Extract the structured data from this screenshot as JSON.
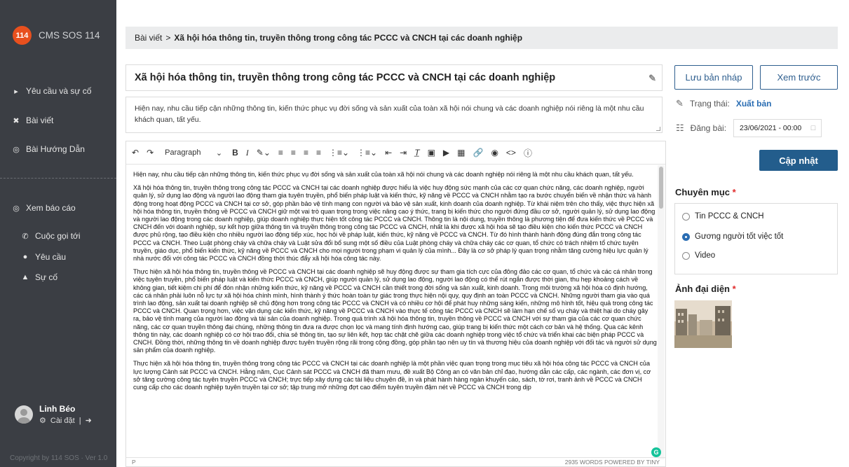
{
  "sidebar": {
    "brand_badge": "114",
    "brand_name": "CMS SOS 114",
    "items": [
      {
        "label": "Yêu cầu và sự cố",
        "icon": "megaphone-icon"
      },
      {
        "label": "Bài viết",
        "icon": "tools-icon"
      },
      {
        "label": "Bài Hướng Dẫn",
        "icon": "compass-icon"
      },
      {
        "label": "Xem báo cáo",
        "icon": "compass-icon"
      },
      {
        "label": "Cuộc gọi tới",
        "icon": "phone-icon"
      },
      {
        "label": "Yêu cầu",
        "icon": "chat-icon"
      },
      {
        "label": "Sự cố",
        "icon": "fire-icon"
      }
    ],
    "user_name": "Linh Béo",
    "settings_label": "Cài đặt",
    "divider": "|",
    "copyright": "Copyright by 114 SOS · Ver 1.0"
  },
  "breadcrumb": {
    "root": "Bài viết",
    "separator": ">",
    "current": "Xã hội hóa thông tin, truyền thông trong công tác PCCC và CNCH tại các doanh nghiệp"
  },
  "post": {
    "title": "Xã hội hóa thông tin, truyền thông  trong công tác PCCC và CNCH tại các doanh nghiệp",
    "summary": "Hiện nay, nhu cầu tiếp cận những thông tin, kiến thức phục vụ đời sống và sản xuất của toàn xã hội nói chung và các doanh nghiệp nói riêng là một nhu cầu khách quan, tất yếu."
  },
  "editor": {
    "format_select": "Paragraph",
    "paragraphs": [
      "Hiện nay, nhu cầu tiếp cận những thông tin, kiến thức phục vụ đời sống và sản xuất của toàn xã hội nói chung và các doanh nghiệp nói riêng là một nhu cầu khách quan, tất yếu.",
      "Xã hội hóa thông tin, truyền thông trong công tác PCCC và CNCH tại các doanh nghiệp được hiểu là việc huy động sức mạnh của các cơ quan chức năng, các doanh nghiệp, người quản lý, sử dụng lao động và người lao động tham gia tuyên truyền, phổ biến pháp luật và kiến thức, kỹ năng về PCCC và CNCH nhằm tạo ra bước chuyển biến về nhận thức và hành động trong hoạt động PCCC và CNCH tại cơ sở, góp phần bảo vệ tính mạng con người và bảo vệ sản xuất, kinh doanh của doanh nghiệp. Từ khái niệm trên cho thấy, việc thực hiện xã hội hóa thông tin, truyền thông về PCCC và CNCH giữ một vai trò quan trọng trong việc nâng cao ý thức, trang bị kiến thức cho người đứng đầu cơ sở, người quản lý, sử dụng lao động và người lao động trong các doanh nghiệp, giúp doanh nghiệp thực hiện tốt công tác PCCC và CNCH. Thông tin là nội dung, truyền thông là phương tiện để đưa kiến thức về PCCC và CNCH đến với doanh nghiệp, sự kết hợp giữa thông tin và truyền thông trong công tác PCCC và CNCH, nhất là khi được xã hội hóa sẽ tạo điều kiện cho kiến thức PCCC và CNCH được phủ rộng, tạo điều kiện cho nhiều người lao động tiếp xúc, học hỏi về pháp luật, kiến thức, kỹ năng về PCCC và CNCH. Từ đó hình thành hành động đúng đắn trong công tác PCCC và CNCH. Theo Luật phòng cháy và chữa cháy và Luật sửa đổi bổ sung một số điều của Luật phòng cháy và chữa cháy các cơ quan, tổ chức có trách nhiệm tổ chức tuyên truyền, giáo dục, phổ biến kiến thức, kỹ năng về PCCC và CNCH cho mọi người trong phạm vi quản lý của mình... Đây là cơ sở pháp lý quan trọng nhằm tăng cường hiệu lực quản lý nhà nước đối với công tác PCCC và CNCH đồng thời thúc đẩy xã hội hóa công tác này.",
      "Thực hiện xã hội hóa thông tin, truyền thông về PCCC và CNCH tại các doanh nghiệp sẽ huy động được sự tham gia tích cực của đông đảo các cơ quan, tổ chức và các cá nhân trong việc tuyên truyền, phổ biến pháp luật và kiến thức PCCC và CNCH, giúp người quản lý, sử dụng lao động, người lao động có thể rút ngắn được thời gian, thu hẹp khoảng cách về không gian, tiết kiệm chi phí để đón nhận những kiến thức, kỹ năng về PCCC và CNCH cần thiết trong đời sống và sản xuất, kinh doanh. Trong môi trường xã hội hóa có định hướng, các cá nhân phải luôn nỗ lực tự xã hội hóa chính mình, hình thành ý thức hoàn toàn tự giác trong thực hiện nội quy, quy định an toàn PCCC và CNCH. Những người tham gia vào quá trình lao động, sản xuất tại doanh nghiệp sẽ chủ động hơn trong công tác PCCC và CNCH và có nhiều cơ hội để phát huy những sáng kiến, những mô hình tốt, hiệu quả trong công tác PCCC và CNCH. Quan trọng hơn, việc vận dụng các kiến thức, kỹ năng về PCCC và CNCH vào thực tế công tác PCCC và CNCH sẽ làm hạn chế số vụ cháy và thiệt hại do cháy gây ra, bảo vệ tính mạng của người lao động và tài sản của doanh nghiệp. Trong quá trình xã hội hóa thông tin, truyền thông về PCCC và CNCH với sự tham gia của các cơ quan chức năng, các cơ quan truyền thông đại chúng, những thông tin đưa ra được chọn lọc và mang tính định hướng cao, giúp trang bị kiến thức một cách cơ bản và hệ thống. Qua các kênh thông tin này, các doanh nghiệp có cơ hội trao đổi, chia sẻ thông tin, tạo sự liên kết, hợp tác chặt chẽ giữa các doanh nghiệp trong việc tổ chức và triển khai các biện pháp PCCC và CNCH. Đồng thời, những thông tin về doanh nghiệp được tuyên truyền rộng rãi trong cộng đồng, góp phần tạo nên uy tín và thương hiệu của doanh nghiệp với đối tác và người sử dụng sản phẩm của doanh nghiệp.",
      "Thực hiện xã hội hóa thông tin, truyền thông trong công tác PCCC và CNCH tại các doanh nghiệp là một phần việc quan trọng trong mục tiêu xã hội hóa công tác PCCC và CNCH của lực lượng Cảnh sát PCCC và CNCH. Hằng năm, Cục Cảnh sát PCCC và CNCH đã tham mưu, đề xuất Bộ Công an có văn bản chỉ đạo, hướng dẫn các cấp, các ngành, các đơn vị, cơ sở tăng cường công tác tuyên truyền PCCC và CNCH; trực tiếp xây dựng các tài liệu chuyên đề, in và phát hành hàng ngàn khuyến cáo, sách, tờ rơi, tranh ảnh về PCCC và CNCH cung cấp cho các doanh nghiệp tuyên truyền tại cơ sở; tập trung mở những đợt cao điểm tuyên truyền đậm nét về PCCC và CNCH trong dịp"
    ],
    "status_path": "P",
    "status_info": "2935 WORDS  POWERED BY TINY",
    "grammarly_badge": "G"
  },
  "actions": {
    "save_draft": "Lưu bản nháp",
    "preview": "Xem trước",
    "status_label": "Trạng thái:",
    "status_value": "Xuất bản",
    "publish_label": "Đăng bài:",
    "publish_date": "23/06/2021 - 00:00",
    "update": "Cập nhật"
  },
  "category": {
    "title": "Chuyên mục",
    "required_mark": "*",
    "options": [
      "Tin PCCC & CNCH",
      "Gương người tốt việc tốt",
      "Video"
    ],
    "selected_index": 1
  },
  "avatar_section": {
    "title": "Ảnh đại diện",
    "required_mark": "*"
  },
  "colors": {
    "sidebar_bg": "#3b3e44",
    "brand_logo": "#e8501e",
    "primary": "#235d8c",
    "link": "#2a6db3",
    "required": "#e02a2a"
  }
}
